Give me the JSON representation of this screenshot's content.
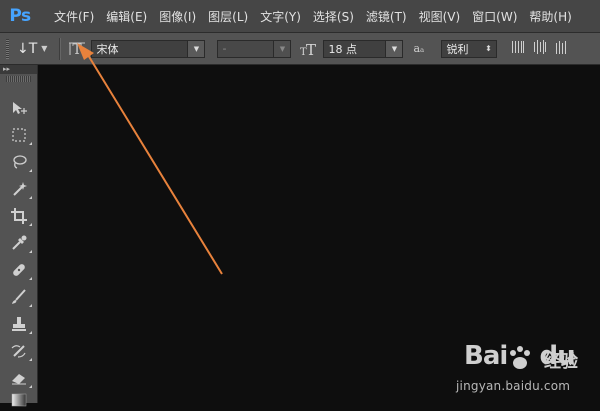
{
  "app": {
    "logo": "Ps"
  },
  "menu": [
    "文件(F)",
    "编辑(E)",
    "图像(I)",
    "图层(L)",
    "文字(Y)",
    "选择(S)",
    "滤镜(T)",
    "视图(V)",
    "窗口(W)",
    "帮助(H)"
  ],
  "options": {
    "tool_glyph": "↓T",
    "font_family": "宋体",
    "font_style": "-",
    "font_size": "18 点",
    "aa_icon": "aₐ",
    "antialias": "锐利"
  },
  "toolbar": {
    "header": "▸▸",
    "tools": [
      "move-tool",
      "marquee-tool",
      "lasso-tool",
      "magic-wand-tool",
      "crop-tool",
      "eyedropper-tool",
      "healing-brush-tool",
      "brush-tool",
      "clone-stamp-tool",
      "history-brush-tool",
      "eraser-tool",
      "gradient-tool"
    ]
  },
  "annotation": {
    "color": "#e8823c"
  },
  "watermark": {
    "logo": "Bai    du",
    "jingyan": "经验",
    "url": "jingyan.baidu.com"
  }
}
